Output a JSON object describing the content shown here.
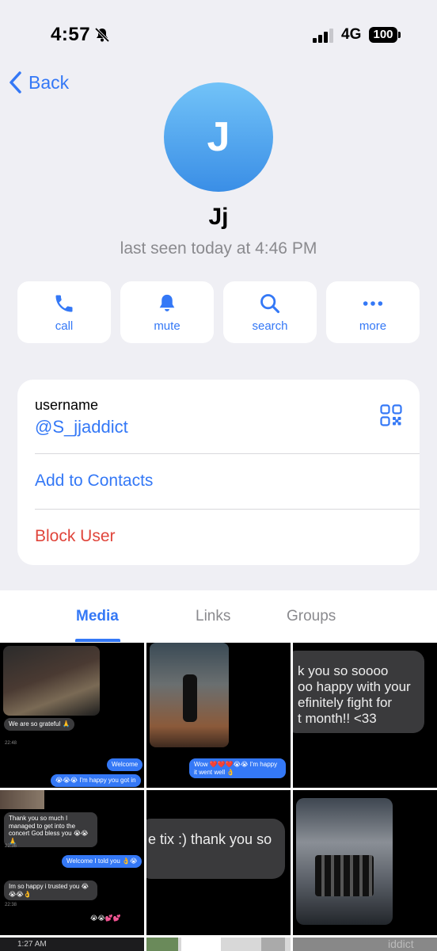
{
  "status_bar": {
    "time": "4:57",
    "network": "4G",
    "battery": "100"
  },
  "header": {
    "back_label": "Back",
    "avatar_initial": "J",
    "name": "Jj",
    "last_seen": "last seen today at 4:46 PM"
  },
  "actions": [
    {
      "label": "call",
      "icon": "phone-icon"
    },
    {
      "label": "mute",
      "icon": "bell-icon"
    },
    {
      "label": "search",
      "icon": "search-icon"
    },
    {
      "label": "more",
      "icon": "more-icon"
    }
  ],
  "info": {
    "username_label": "username",
    "username": "@S_jjaddict",
    "add_contacts": "Add to Contacts",
    "block_user": "Block User"
  },
  "tabs": [
    {
      "label": "Media"
    },
    {
      "label": "Links"
    },
    {
      "label": "Groups"
    }
  ],
  "media": {
    "cell1": {
      "msg1": "We are so grateful 🙏",
      "msg2": "Welcome",
      "msg3": "😭😭😭 I'm happy you got in"
    },
    "cell2": {
      "msg1": "Wow ❤️❤️❤️😭😭 I'm happy it went well 👌"
    },
    "cell3": {
      "lines": [
        "k you so soooo",
        "oo happy with your",
        "efinitely fight for",
        "t month!! <33"
      ]
    },
    "cell4": {
      "msg1": "Thank you so much I managed to get into the concert God bless you 😭😭🙏",
      "msg2": "Welcome I told you 👌😭",
      "msg3": "Im so happy i trusted you 😭😭😭👌",
      "msg4": "😭😭💕💕"
    },
    "cell5": {
      "line": "e tix :) thank you so"
    },
    "cell7": {
      "time": "1:27 AM"
    },
    "cell9": {
      "text": "iddict"
    }
  },
  "colors": {
    "accent": "#3478f6",
    "danger": "#e0453b",
    "background": "#efeff4"
  }
}
